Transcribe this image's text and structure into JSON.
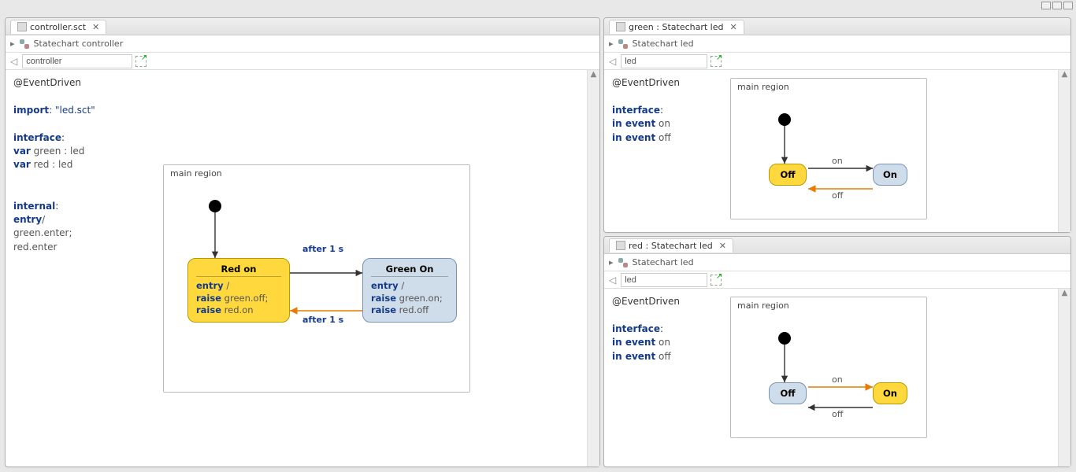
{
  "titlebar": {
    "min": "_",
    "max": "▭",
    "close": "✕"
  },
  "left": {
    "tab": {
      "title": "controller.sct",
      "close": "✕"
    },
    "breadcrumb": {
      "arrow": "▸",
      "label": "Statechart controller"
    },
    "toolbar": {
      "back": "◁",
      "input_value": "controller"
    },
    "code": {
      "annotation": "@EventDriven",
      "import_kw": "import",
      "import_val": ": \"led.sct\"",
      "interface_kw": "interface",
      "colon": ":",
      "var_kw": "var",
      "green_decl": " green : led",
      "red_decl": " red : led",
      "internal_kw": "internal",
      "entry_kw": "entry",
      "slash": "/",
      "l1": "green.enter;",
      "l2": "red.enter"
    },
    "diagram": {
      "region_title": "main region",
      "state_red": {
        "title": "Red on",
        "entry_kw": "entry",
        "slash": "/",
        "raise_kw": "raise",
        "l1_rest": " green.off;",
        "l2_rest": " red.on"
      },
      "state_green": {
        "title": "Green On",
        "entry_kw": "entry",
        "slash": "/",
        "raise_kw": "raise",
        "l1_rest": " green.on;",
        "l2_rest": " red.off"
      },
      "trans_top_after": "after ",
      "trans_top_num": "1",
      "trans_top_unit": " s",
      "trans_bot_after": "after ",
      "trans_bot_num": "1",
      "trans_bot_unit": " s"
    }
  },
  "green": {
    "tab": {
      "title": "green : Statechart led",
      "close": "✕"
    },
    "breadcrumb": {
      "arrow": "▸",
      "label": "Statechart led"
    },
    "toolbar": {
      "back": "◁",
      "input_value": "led"
    },
    "code": {
      "annotation": "@EventDriven",
      "interface_kw": "interface",
      "colon": ":",
      "in_kw": "in event",
      "on": " on",
      "off": " off"
    },
    "diagram": {
      "region_title": "main region",
      "off_title": "Off",
      "on_title": "On",
      "on_label": "on",
      "off_label": "off"
    }
  },
  "red": {
    "tab": {
      "title": "red : Statechart led",
      "close": "✕"
    },
    "breadcrumb": {
      "arrow": "▸",
      "label": "Statechart led"
    },
    "toolbar": {
      "back": "◁",
      "input_value": "led"
    },
    "code": {
      "annotation": "@EventDriven",
      "interface_kw": "interface",
      "colon": ":",
      "in_kw": "in event",
      "on": " on",
      "off": " off"
    },
    "diagram": {
      "region_title": "main region",
      "off_title": "Off",
      "on_title": "On",
      "on_label": "on",
      "off_label": "off"
    }
  }
}
